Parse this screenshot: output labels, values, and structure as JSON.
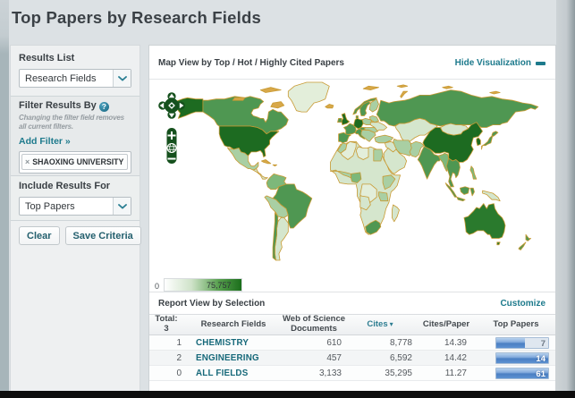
{
  "page": {
    "title": "Top Papers by Research Fields",
    "colors": {
      "accent_teal": "#1d7a8c",
      "link_teal": "#17697a",
      "bar_blue": "#4a7fc3",
      "map_green_high": "#1d6b21",
      "map_green_low": "#e3eeda",
      "map_border_tan": "#c89a33"
    }
  },
  "sidebar": {
    "results_list": {
      "label": "Results List",
      "value": "Research Fields"
    },
    "filter": {
      "label": "Filter Results By",
      "note": "Changing the filter field removes all current filters.",
      "add_filter": "Add Filter »",
      "tag": {
        "remove": "×",
        "text": "SHAOXING UNIVERSITY"
      }
    },
    "include": {
      "label": "Include Results For",
      "value": "Top Papers"
    },
    "buttons": {
      "clear": "Clear",
      "save": "Save Criteria"
    }
  },
  "map": {
    "title": "Map View by Top / Hot / Highly Cited Papers",
    "hide_visualization": "Hide Visualization",
    "legend": {
      "min": "0",
      "max": "75,757",
      "low_color": "#ffffff",
      "high_color": "#1b6e1b"
    }
  },
  "report": {
    "title": "Report View by Selection",
    "customize": "Customize",
    "header": {
      "total_label": "Total:",
      "total_value": "3",
      "fields": "Research Fields",
      "docs_line1": "Web of Science",
      "docs_line2": "Documents",
      "cites": "Cites",
      "cites_sort_icon": "▾",
      "cites_paper": "Cites/Paper",
      "top_papers": "Top Papers"
    },
    "rows": [
      {
        "rank": "1",
        "field": "CHEMISTRY",
        "docs": "610",
        "cites": "8,778",
        "cites_paper": "14.39",
        "top_papers": "7",
        "bar_pct": "55"
      },
      {
        "rank": "2",
        "field": "ENGINEERING",
        "docs": "457",
        "cites": "6,592",
        "cites_paper": "14.42",
        "top_papers": "14",
        "bar_pct": "100"
      },
      {
        "rank": "0",
        "field": "ALL FIELDS",
        "docs": "3,133",
        "cites": "35,295",
        "cites_paper": "11.27",
        "top_papers": "61",
        "bar_pct": "100"
      }
    ]
  }
}
